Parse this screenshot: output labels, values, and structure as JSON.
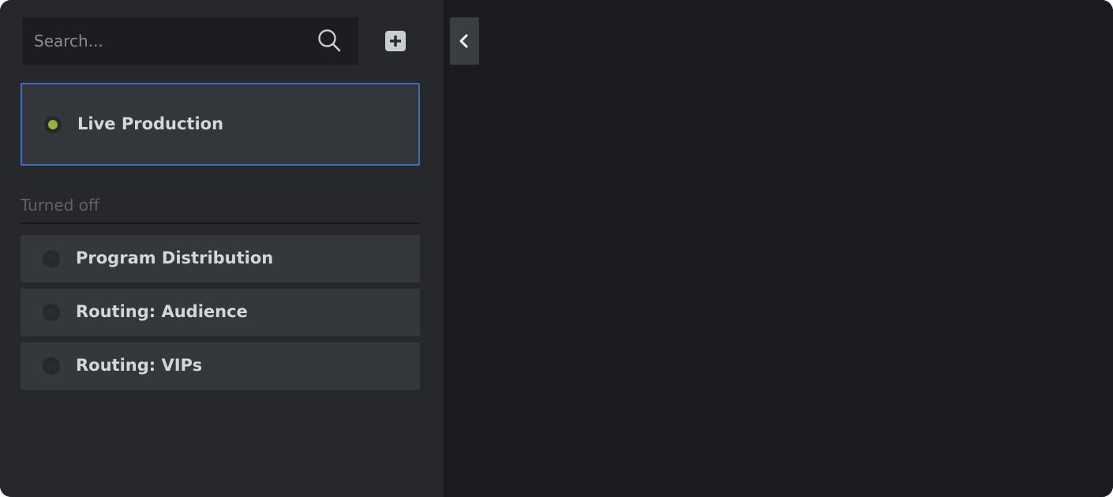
{
  "search": {
    "placeholder": "Search...",
    "value": ""
  },
  "actions": {
    "add_icon": "plus-square-icon",
    "collapse_icon": "chevron-left-icon"
  },
  "active_items": [
    {
      "label": "Live Production",
      "status": "on",
      "status_color": "#8fb33c"
    }
  ],
  "turned_off_section": {
    "title": "Turned off",
    "items": [
      {
        "label": "Program Distribution",
        "status": "off"
      },
      {
        "label": "Routing: Audience",
        "status": "off"
      },
      {
        "label": "Routing: VIPs",
        "status": "off"
      }
    ]
  },
  "colors": {
    "accent_border": "#3d6cc0",
    "status_on": "#8fb33c",
    "status_off": "#2a2c30"
  }
}
